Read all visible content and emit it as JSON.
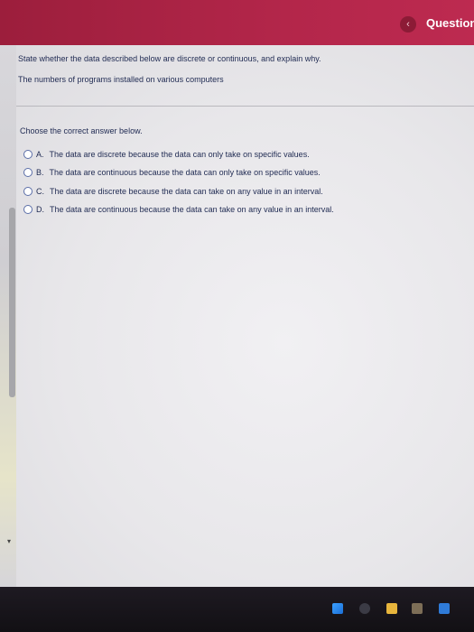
{
  "header": {
    "back_glyph": "‹",
    "title": "Question"
  },
  "question": {
    "text": "State whether the data described below are discrete or continuous, and explain why.",
    "subject": "The numbers of programs installed on various computers"
  },
  "answer": {
    "prompt": "Choose the correct answer below.",
    "options": [
      {
        "letter": "A.",
        "text": "The data are discrete because the data can only take on specific values."
      },
      {
        "letter": "B.",
        "text": "The data are continuous because the data can only take on specific values."
      },
      {
        "letter": "C.",
        "text": "The data are discrete because the data can take on any value in an interval."
      },
      {
        "letter": "D.",
        "text": "The data are continuous because the data can take on any value in an interval."
      }
    ]
  },
  "taskbar": {
    "icons": [
      "windows-start-icon",
      "media-app-icon",
      "file-explorer-icon",
      "store-icon",
      "mail-icon"
    ]
  },
  "colors": {
    "header_bg": "#b3264a",
    "text": "#1f2a52",
    "taskbar_bg": "#141216"
  }
}
